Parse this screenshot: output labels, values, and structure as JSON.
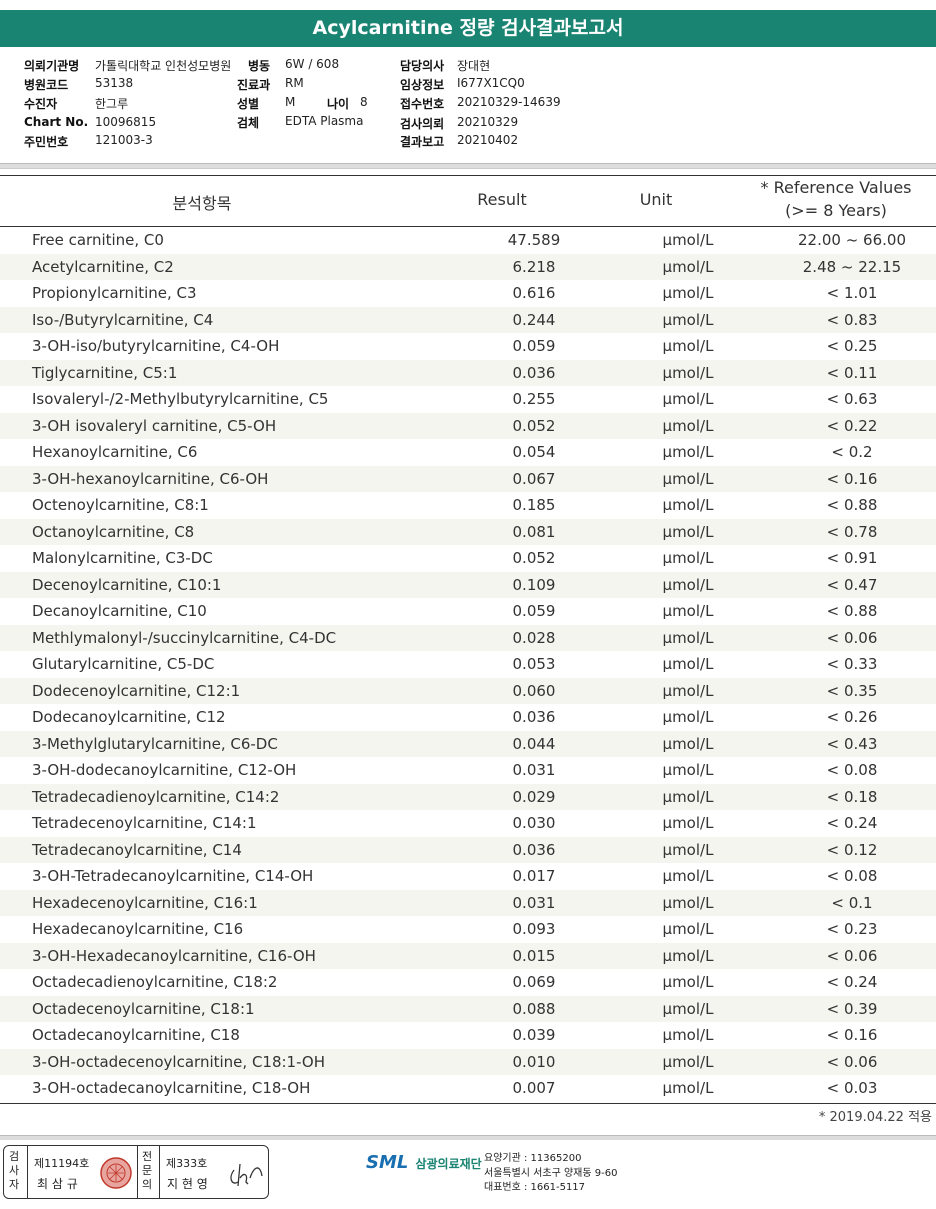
{
  "report": {
    "title": "Acylcarnitine 정량 검사결과보고서"
  },
  "info": {
    "requester_label": "의뢰기관명",
    "requester_value": "가톨릭대학교 인천성모병원",
    "ward_label": "병동",
    "ward_value": "6W / 608",
    "doctor_label": "담당의사",
    "doctor_value": "장대현",
    "hospital_code_label": "병원코드",
    "hospital_code_value": "53138",
    "department_label": "진료과",
    "department_value": "RM",
    "clinical_label": "임상정보",
    "clinical_value": "I677X1CQ0",
    "patient_label": "수진자",
    "patient_value": "한그루",
    "sex_label": "성별",
    "sex_value": "M",
    "age_label": "나이",
    "age_value": "8",
    "accession_label": "접수번호",
    "accession_value": "20210329-14639",
    "chart_label": "Chart No.",
    "chart_value": "10096815",
    "specimen_label": "검체",
    "specimen_value": "EDTA Plasma",
    "requested_label": "검사의뢰",
    "requested_value": "20210329",
    "resident_label": "주민번호",
    "resident_value": "121003-3",
    "reported_label": "결과보고",
    "reported_value": "20210402"
  },
  "table": {
    "headers": {
      "item": "분석항목",
      "result": "Result",
      "unit": "Unit",
      "ref_line1": "* Reference Values",
      "ref_line2": "(>= 8 Years)"
    },
    "rows": [
      {
        "name": "Free carnitine, C0",
        "result": "47.589",
        "unit": "μmol/L",
        "ref": "22.00 ~ 66.00"
      },
      {
        "name": "Acetylcarnitine, C2",
        "result": "6.218",
        "unit": "μmol/L",
        "ref": "2.48 ~ 22.15"
      },
      {
        "name": "Propionylcarnitine, C3",
        "result": "0.616",
        "unit": "μmol/L",
        "ref": "< 1.01"
      },
      {
        "name": "Iso-/Butyrylcarnitine, C4",
        "result": "0.244",
        "unit": "μmol/L",
        "ref": "< 0.83"
      },
      {
        "name": "3-OH-iso/butyrylcarnitine, C4-OH",
        "result": "0.059",
        "unit": "μmol/L",
        "ref": "< 0.25"
      },
      {
        "name": "Tiglycarnitine, C5:1",
        "result": "0.036",
        "unit": "μmol/L",
        "ref": "< 0.11"
      },
      {
        "name": "Isovaleryl-/2-Methylbutyrylcarnitine, C5",
        "result": "0.255",
        "unit": "μmol/L",
        "ref": "< 0.63"
      },
      {
        "name": "3-OH isovaleryl carnitine, C5-OH",
        "result": "0.052",
        "unit": "μmol/L",
        "ref": "< 0.22"
      },
      {
        "name": "Hexanoylcarnitine, C6",
        "result": "0.054",
        "unit": "μmol/L",
        "ref": "< 0.2"
      },
      {
        "name": "3-OH-hexanoylcarnitine, C6-OH",
        "result": "0.067",
        "unit": "μmol/L",
        "ref": "< 0.16"
      },
      {
        "name": "Octenoylcarnitine, C8:1",
        "result": "0.185",
        "unit": "μmol/L",
        "ref": "< 0.88"
      },
      {
        "name": "Octanoylcarnitine, C8",
        "result": "0.081",
        "unit": "μmol/L",
        "ref": "< 0.78"
      },
      {
        "name": "Malonylcarnitine, C3-DC",
        "result": "0.052",
        "unit": "μmol/L",
        "ref": "< 0.91"
      },
      {
        "name": "Decenoylcarnitine, C10:1",
        "result": "0.109",
        "unit": "μmol/L",
        "ref": "< 0.47"
      },
      {
        "name": "Decanoylcarnitine, C10",
        "result": "0.059",
        "unit": "μmol/L",
        "ref": "< 0.88"
      },
      {
        "name": "Methlymalonyl-/succinylcarnitine, C4-DC",
        "result": "0.028",
        "unit": "μmol/L",
        "ref": "< 0.06"
      },
      {
        "name": "Glutarylcarnitine, C5-DC",
        "result": "0.053",
        "unit": "μmol/L",
        "ref": "< 0.33"
      },
      {
        "name": "Dodecenoylcarnitine, C12:1",
        "result": "0.060",
        "unit": "μmol/L",
        "ref": "< 0.35"
      },
      {
        "name": "Dodecanoylcarnitine, C12",
        "result": "0.036",
        "unit": "μmol/L",
        "ref": "< 0.26"
      },
      {
        "name": "3-Methylglutarylcarnitine, C6-DC",
        "result": "0.044",
        "unit": "μmol/L",
        "ref": "< 0.43"
      },
      {
        "name": "3-OH-dodecanoylcarnitine, C12-OH",
        "result": "0.031",
        "unit": "μmol/L",
        "ref": "< 0.08"
      },
      {
        "name": "Tetradecadienoylcarnitine, C14:2",
        "result": "0.029",
        "unit": "μmol/L",
        "ref": "< 0.18"
      },
      {
        "name": "Tetradecenoylcarnitine, C14:1",
        "result": "0.030",
        "unit": "μmol/L",
        "ref": "< 0.24"
      },
      {
        "name": "Tetradecanoylcarnitine, C14",
        "result": "0.036",
        "unit": "μmol/L",
        "ref": "< 0.12"
      },
      {
        "name": "3-OH-Tetradecanoylcarnitine, C14-OH",
        "result": "0.017",
        "unit": "μmol/L",
        "ref": "< 0.08"
      },
      {
        "name": "Hexadecenoylcarnitine, C16:1",
        "result": "0.031",
        "unit": "μmol/L",
        "ref": "< 0.1"
      },
      {
        "name": "Hexadecanoylcarnitine, C16",
        "result": "0.093",
        "unit": "μmol/L",
        "ref": "< 0.23"
      },
      {
        "name": "3-OH-Hexadecanoylcarnitine, C16-OH",
        "result": "0.015",
        "unit": "μmol/L",
        "ref": "< 0.06"
      },
      {
        "name": "Octadecadienoylcarnitine, C18:2",
        "result": "0.069",
        "unit": "μmol/L",
        "ref": "< 0.24"
      },
      {
        "name": "Octadecenoylcarnitine, C18:1",
        "result": "0.088",
        "unit": "μmol/L",
        "ref": "< 0.39"
      },
      {
        "name": "Octadecanoylcarnitine, C18",
        "result": "0.039",
        "unit": "μmol/L",
        "ref": "< 0.16"
      },
      {
        "name": "3-OH-octadecenoylcarnitine, C18:1-OH",
        "result": "0.010",
        "unit": "μmol/L",
        "ref": "< 0.06"
      },
      {
        "name": "3-OH-octadecanoylcarnitine, C18-OH",
        "result": "0.007",
        "unit": "μmol/L",
        "ref": "< 0.03"
      }
    ],
    "ref_note": "* 2019.04.22 적용"
  },
  "footer": {
    "examiner_label": "검사자",
    "examiner_license": "제11194호",
    "examiner_name": "최 삼 규",
    "specialist_label": "전문의",
    "specialist_license": "제333호",
    "specialist_name": "지 현 영",
    "brand_short": "SML",
    "brand_name": "삼광의료재단",
    "care_code": "요양기관 : 11365200",
    "address": "서울특별시 서초구 양재동 9-60",
    "phone": "대표번호 : 1661-5117",
    "brand_color": "#1a8473"
  }
}
